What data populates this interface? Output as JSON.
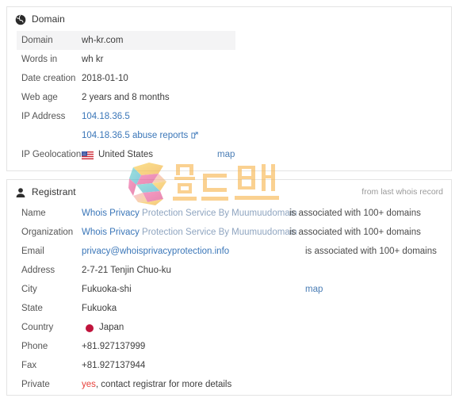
{
  "domain_card": {
    "title": "Domain",
    "icon": "globe-icon",
    "rows": [
      {
        "label": "Domain",
        "value": "wh-kr.com",
        "shaded": true
      },
      {
        "label": "Words in",
        "value": "wh kr",
        "shaded": false
      },
      {
        "label": "Date creation",
        "value": "2018-01-10",
        "shaded": false
      },
      {
        "label": "Web age",
        "value": "2 years and 8 months",
        "shaded": false
      },
      {
        "label": "IP Address",
        "value": "104.18.36.5",
        "shaded": false
      },
      {
        "label": "",
        "value": "104.18.36.5 abuse reports",
        "shaded": false
      },
      {
        "label": "IP Geolocation",
        "value": "United States",
        "shaded": false
      }
    ],
    "abuse_reports_link": "104.18.36.5 abuse reports",
    "ip_address_link": "104.18.36.5",
    "geolocation_country": "United States",
    "geolocation_flag": "flag-united-states-icon",
    "map_label": "map"
  },
  "registrant_card": {
    "title": "Registrant",
    "icon": "user-icon",
    "note": "from last whois record",
    "associated_text": "is associated with 100+ domains",
    "map_label": "map",
    "rows": [
      {
        "label": "Name",
        "link_strong": "Whois Privacy",
        "link_soft": " Protection Service By Muumuudomain"
      },
      {
        "label": "Organization",
        "link_strong": "Whois Privacy",
        "link_soft": " Protection Service By Muumuudomain"
      },
      {
        "label": "Email",
        "link_strong": "privacy@whoisprivacyprotection.info",
        "link_soft": ""
      },
      {
        "label": "Address",
        "value": "2-7-21 Tenjin Chuo-ku"
      },
      {
        "label": "City",
        "value": "Fukuoka-shi"
      },
      {
        "label": "State",
        "value": "Fukuoka"
      },
      {
        "label": "Country",
        "value": "Japan",
        "flag": "flag-japan-icon"
      },
      {
        "label": "Phone",
        "value": "+81.927137999"
      },
      {
        "label": "Fax",
        "value": "+81.927137944"
      },
      {
        "label": "Private",
        "value_red": "yes",
        "value_rest": ", contact registrar for more details"
      }
    ]
  },
  "watermark": {
    "logo_letter": "S",
    "text": "쉴드맨",
    "accent": "#f7b64f"
  },
  "colors": {
    "link": "#3a76b8",
    "link_soft": "#8fa5c0",
    "red": "#e8403a",
    "shade": "#f4f4f5",
    "border": "#e4e4e4"
  }
}
